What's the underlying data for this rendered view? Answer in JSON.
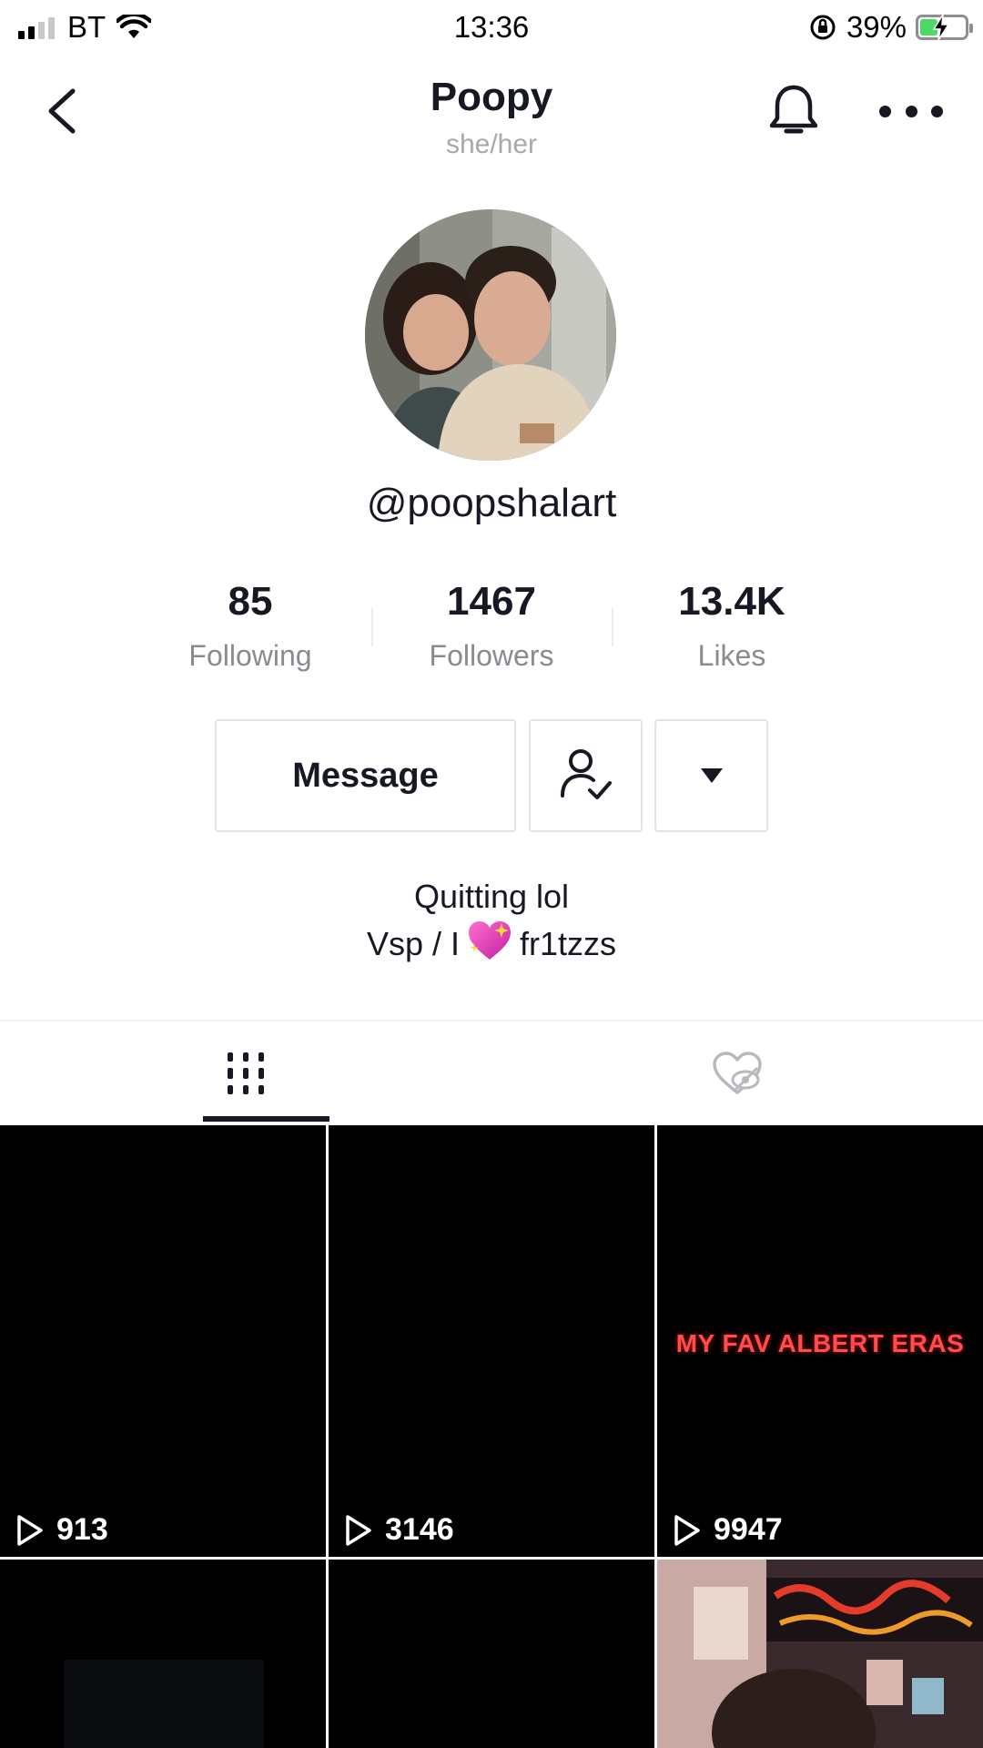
{
  "status_bar": {
    "carrier": "BT",
    "time": "13:36",
    "battery_percent": "39%",
    "battery_level": 0.39,
    "battery_charging": true
  },
  "header": {
    "title": "Poopy",
    "pronouns": "she/her",
    "back_icon": "chevron-left-icon",
    "bell_icon": "bell-icon",
    "more_icon": "more-horizontal-icon"
  },
  "profile": {
    "username": "@poopshalart"
  },
  "stats": {
    "following": {
      "value": "85",
      "label": "Following"
    },
    "followers": {
      "value": "1467",
      "label": "Followers"
    },
    "likes": {
      "value": "13.4K",
      "label": "Likes"
    }
  },
  "actions": {
    "message_label": "Message",
    "following_icon": "user-check-icon",
    "dropdown_icon": "caret-down-icon"
  },
  "bio": {
    "line1": "Quitting lol",
    "line2_prefix": "Vsp / I",
    "line2_suffix": "fr1tzzs",
    "emoji": "sparkling-heart-icon"
  },
  "tabs": [
    {
      "name": "videos",
      "icon": "grid-icon",
      "active": true
    },
    {
      "name": "liked",
      "icon": "hidden-heart-icon",
      "active": false
    }
  ],
  "videos": [
    {
      "views": "913",
      "caption": ""
    },
    {
      "views": "3146",
      "caption": ""
    },
    {
      "views": "9947",
      "caption": "MY FAV ALBERT ERAS"
    },
    {
      "views": "",
      "caption": ""
    },
    {
      "views": "",
      "caption": ""
    },
    {
      "views": "",
      "caption": ""
    }
  ],
  "colors": {
    "text_primary": "#161823",
    "text_secondary": "#8a8b91",
    "accent_red": "#ff4d4d",
    "battery_green": "#4cd964"
  }
}
